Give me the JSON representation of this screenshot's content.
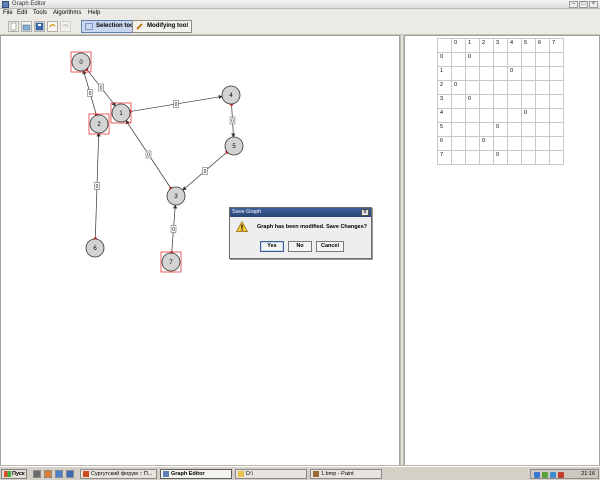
{
  "window": {
    "title": "Graph Editor"
  },
  "menu": {
    "items": [
      "File",
      "Edit",
      "Tools",
      "Algorithms",
      "Help"
    ]
  },
  "toolbar": {
    "icons": [
      "new-file-icon",
      "open-file-icon",
      "save-icon",
      "undo-icon",
      "redo-icon"
    ],
    "selection_tool": "Selection tool",
    "modifying_tool": "Modifying tool"
  },
  "graph": {
    "nodes": [
      "0",
      "1",
      "2",
      "3",
      "4",
      "5",
      "6",
      "7"
    ],
    "edge_weight": "0",
    "selected_nodes": [
      "0",
      "1",
      "2",
      "7"
    ]
  },
  "matrix": {
    "headers": [
      "0",
      "1",
      "2",
      "3",
      "4",
      "5",
      "6",
      "7"
    ],
    "rows": [
      {
        "label": "0",
        "cells": [
          "",
          "0",
          "",
          "",
          "",
          "",
          "",
          ""
        ]
      },
      {
        "label": "1",
        "cells": [
          "",
          "",
          "",
          "",
          "0",
          "",
          "",
          ""
        ]
      },
      {
        "label": "2",
        "cells": [
          "0",
          "",
          "",
          "",
          "",
          "",
          "",
          ""
        ]
      },
      {
        "label": "3",
        "cells": [
          "",
          "0",
          "",
          "",
          "",
          "",
          "",
          ""
        ]
      },
      {
        "label": "4",
        "cells": [
          "",
          "",
          "",
          "",
          "",
          "0",
          "",
          ""
        ]
      },
      {
        "label": "5",
        "cells": [
          "",
          "",
          "",
          "0",
          "",
          "",
          "",
          ""
        ]
      },
      {
        "label": "6",
        "cells": [
          "",
          "",
          "0",
          "",
          "",
          "",
          "",
          ""
        ]
      },
      {
        "label": "7",
        "cells": [
          "",
          "",
          "",
          "0",
          "",
          "",
          "",
          ""
        ]
      }
    ]
  },
  "dialog": {
    "title": "Save Graph",
    "close": "x",
    "message": "Graph has been modified. Save Changes?",
    "yes": "Yes",
    "no": "No",
    "cancel": "Cancel"
  },
  "taskbar": {
    "start": "Пуск",
    "tasks": [
      "Сургутский форум :: П...",
      "Graph Editor",
      "D:\\",
      "1.bmp - Paint"
    ],
    "clock": "21:16"
  },
  "colors": {
    "accent": "#3d5e99",
    "selection_red": "#e02020",
    "node_fill": "#d3d3d3"
  }
}
